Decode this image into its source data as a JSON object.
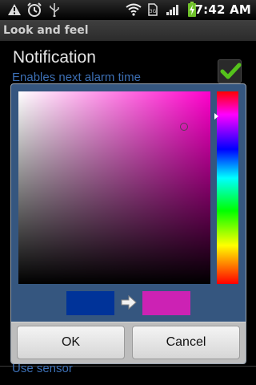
{
  "status_bar": {
    "icons": [
      "warning-icon",
      "alarm-clock-icon",
      "usb-icon",
      "wifi-icon",
      "sim-card-icon",
      "signal-icon",
      "battery-charging-icon"
    ],
    "time": "7:42 AM"
  },
  "screen": {
    "title": "Look and feel",
    "preference": {
      "title": "Notification",
      "summary": "Enables next alarm time",
      "checked": true
    },
    "next_preference_summary": "Use sensor"
  },
  "dialog": {
    "old_color": "#003399",
    "new_color": "#cc22b4",
    "hue_color": "#ff00cc",
    "ok_label": "OK",
    "cancel_label": "Cancel"
  }
}
